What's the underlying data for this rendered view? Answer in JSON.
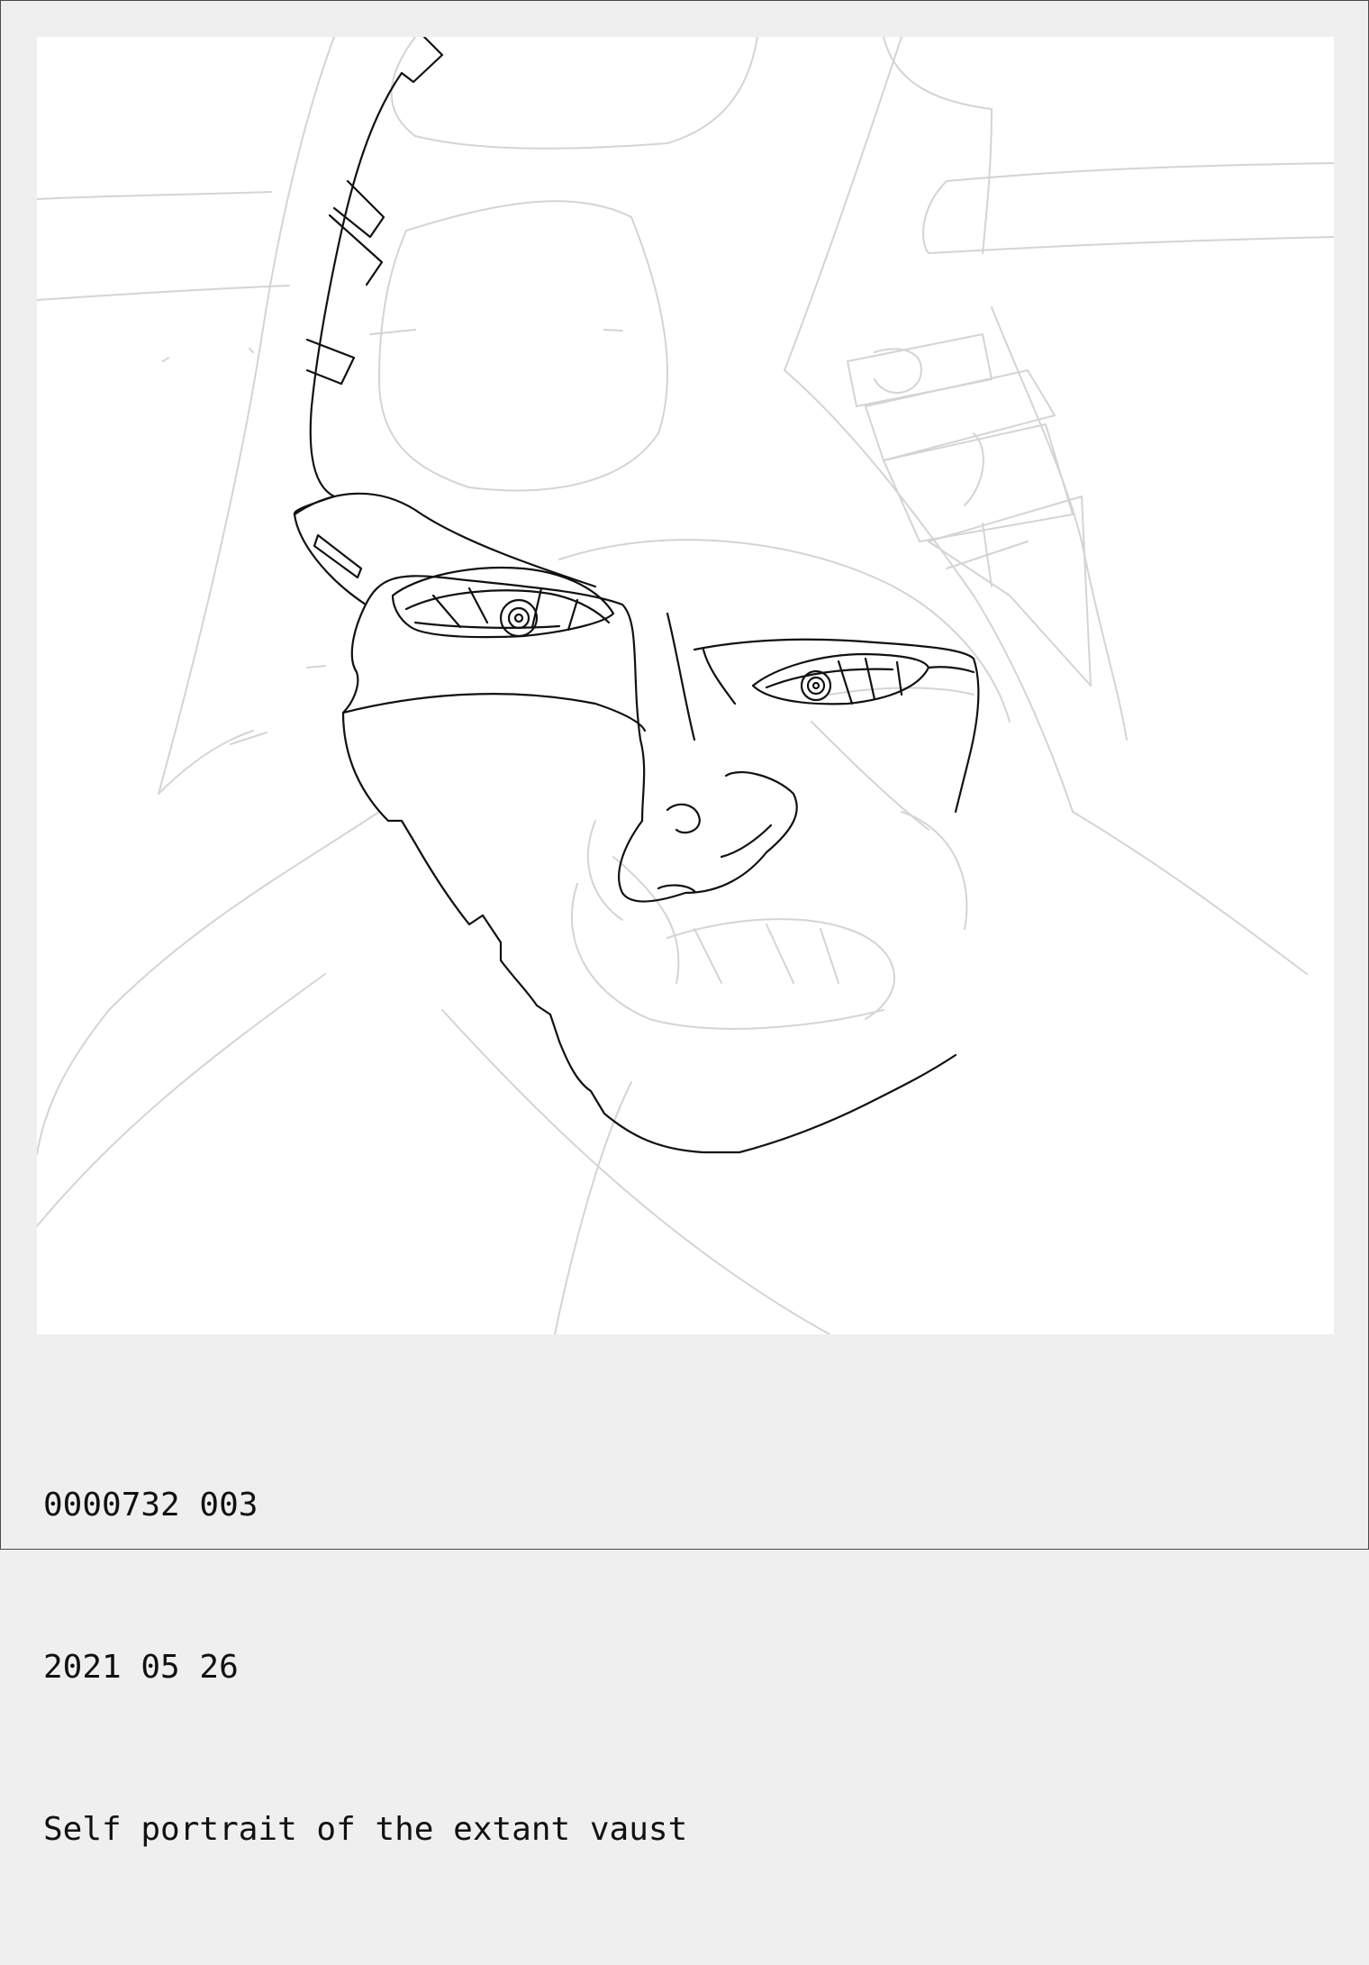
{
  "caption": {
    "id": "0000732 003",
    "date": "2021 05 26",
    "title": "Self portrait of the extant vaust"
  },
  "colors": {
    "background": "#efefef",
    "canvas": "#ffffff",
    "sketch_line": "#d4d4d4",
    "ink_line": "#111111",
    "text": "#111111"
  }
}
